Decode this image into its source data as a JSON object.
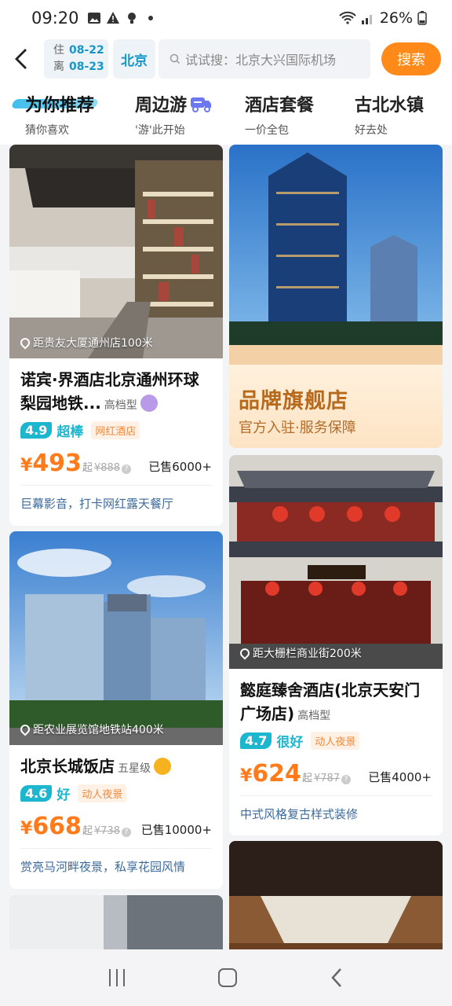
{
  "status": {
    "time": "09:20",
    "battery": "26%"
  },
  "header": {
    "checkin_label": "住",
    "checkin_date": "08-22",
    "checkout_label": "离",
    "checkout_date": "08-23",
    "city": "北京",
    "search_placeholder": "试试搜：北京大兴国际机场",
    "search_button": "搜索"
  },
  "tabs": [
    {
      "title": "为你推荐",
      "subtitle": "猜你喜欢"
    },
    {
      "title": "周边游",
      "subtitle": "'游'此开始"
    },
    {
      "title": "酒店套餐",
      "subtitle": "一价全包"
    },
    {
      "title": "古北水镇",
      "subtitle": "好去处"
    }
  ],
  "cards": {
    "hotel1": {
      "distance": "距贵友大厦通州店100米",
      "name": "诺宾·界酒店北京通州环球梨园地铁...",
      "grade": "高档型",
      "score": "4.9",
      "score_word": "超棒",
      "tag": "网红酒店",
      "price": "493",
      "price_suffix": "起",
      "orig_price": "¥888",
      "sold": "已售6000+",
      "desc": "巨幕影音，打卡网红露天餐厅"
    },
    "promo": {
      "title": "品牌旗舰店",
      "subtitle": "官方入驻·服务保障"
    },
    "hotel2": {
      "distance": "距大栅栏商业街200米",
      "name": "懿庭臻舍酒店(北京天安门广场店)",
      "grade": "高档型",
      "score": "4.7",
      "score_word": "很好",
      "tag": "动人夜景",
      "price": "624",
      "price_suffix": "起",
      "orig_price": "¥787",
      "sold": "已售4000+",
      "desc": "中式风格复古样式装修"
    },
    "hotel3": {
      "distance": "距农业展览馆地铁站400米",
      "name": "北京长城饭店",
      "grade": "五星级",
      "score": "4.6",
      "score_word": "好",
      "tag": "动人夜景",
      "price": "668",
      "price_suffix": "起",
      "orig_price": "¥738",
      "sold": "已售10000+",
      "desc": "赏亮马河畔夜景，私享花园风情"
    }
  },
  "colors": {
    "accent": "#ff8a1a",
    "teal": "#1cb6cf",
    "link": "#3d6a9a"
  },
  "currency": "¥"
}
